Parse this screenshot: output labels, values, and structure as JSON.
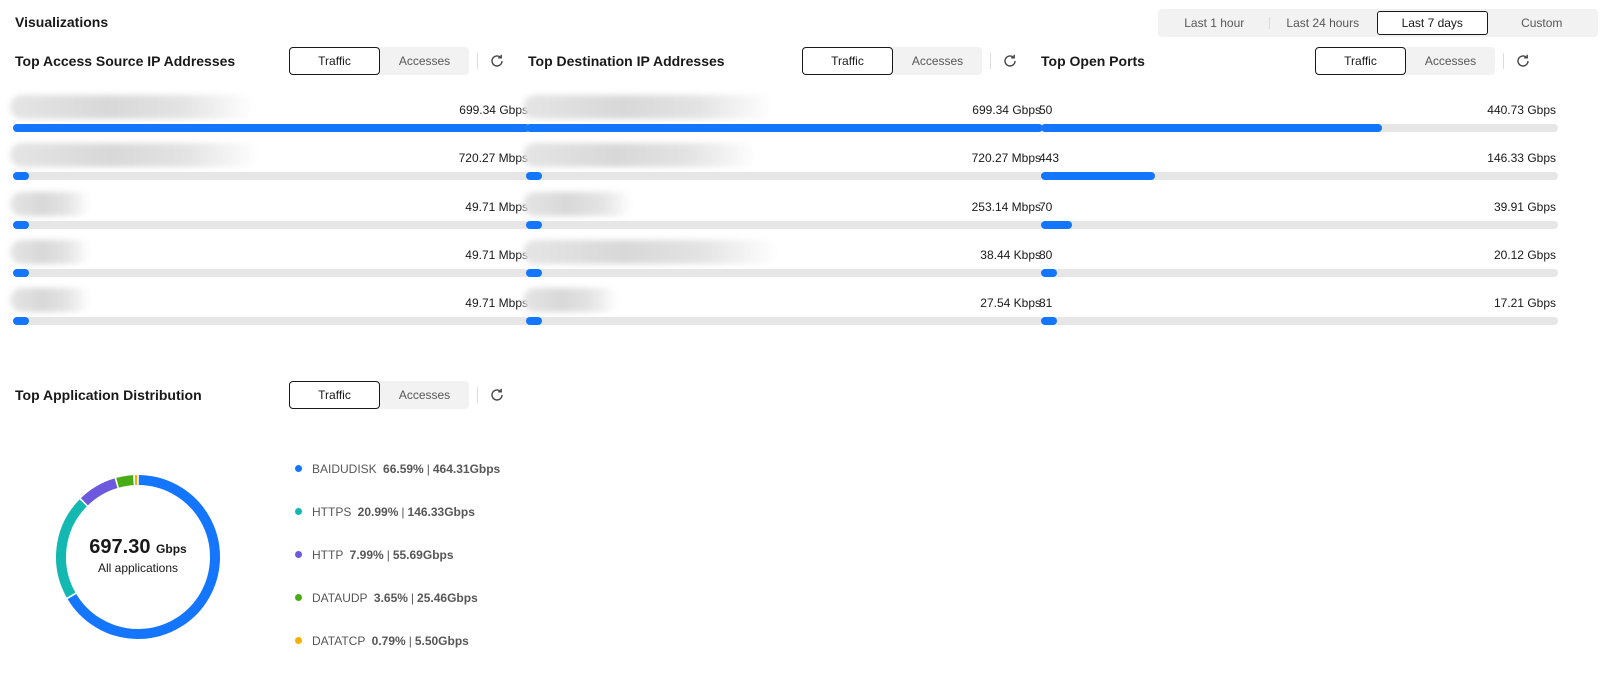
{
  "page": {
    "title": "Visualizations"
  },
  "time_range": {
    "options": [
      "Last 1 hour",
      "Last 24 hours",
      "Last 7 days",
      "Custom"
    ],
    "selected": "Last 7 days"
  },
  "panels": {
    "source_ip": {
      "title": "Top Access Source IP Addresses",
      "tabs": [
        "Traffic",
        "Accesses"
      ],
      "active_tab": "Traffic",
      "rows": [
        {
          "label": "",
          "value": "699.34 Gbps",
          "fraction": 1.0
        },
        {
          "label": "",
          "value": "720.27 Mbps",
          "fraction": 0.03
        },
        {
          "label": "",
          "value": "49.71 Mbps",
          "fraction": 0.03
        },
        {
          "label": "",
          "value": "49.71 Mbps",
          "fraction": 0.03
        },
        {
          "label": "",
          "value": "49.71 Mbps",
          "fraction": 0.03
        }
      ]
    },
    "dest_ip": {
      "title": "Top Destination IP Addresses",
      "tabs": [
        "Traffic",
        "Accesses"
      ],
      "active_tab": "Traffic",
      "rows": [
        {
          "label": "",
          "value": "699.34 Gbps",
          "fraction": 1.0
        },
        {
          "label": "",
          "value": "720.27 Mbps",
          "fraction": 0.03
        },
        {
          "label": "",
          "value": "253.14 Mbps",
          "fraction": 0.03
        },
        {
          "label": "",
          "value": "38.44 Kbps",
          "fraction": 0.03
        },
        {
          "label": "",
          "value": "27.54 Kbps",
          "fraction": 0.03
        }
      ]
    },
    "open_ports": {
      "title": "Top Open Ports",
      "tabs": [
        "Traffic",
        "Accesses"
      ],
      "active_tab": "Traffic",
      "rows": [
        {
          "label": "50",
          "value": "440.73 Gbps",
          "fraction": 0.66
        },
        {
          "label": "443",
          "value": "146.33 Gbps",
          "fraction": 0.22
        },
        {
          "label": "70",
          "value": "39.91 Gbps",
          "fraction": 0.06
        },
        {
          "label": "80",
          "value": "20.12 Gbps",
          "fraction": 0.03
        },
        {
          "label": "81",
          "value": "17.21 Gbps",
          "fraction": 0.03
        }
      ]
    },
    "app_dist": {
      "title": "Top Application Distribution",
      "tabs": [
        "Traffic",
        "Accesses"
      ],
      "active_tab": "Traffic",
      "total_value": "697.30",
      "total_unit": "Gbps",
      "total_label": "All applications",
      "chart_data": {
        "type": "pie",
        "series": [
          {
            "name": "BAIDUDISK",
            "percent": 66.59,
            "value": "464.31Gbps",
            "percent_label": "66.59%",
            "color": "#1476ff"
          },
          {
            "name": "HTTPS",
            "percent": 20.99,
            "value": "146.33Gbps",
            "percent_label": "20.99%",
            "color": "#13b8b0"
          },
          {
            "name": "HTTP",
            "percent": 7.99,
            "value": "55.69Gbps",
            "percent_label": "7.99%",
            "color": "#6c59de"
          },
          {
            "name": "DATAUDP",
            "percent": 3.65,
            "value": "25.46Gbps",
            "percent_label": "3.65%",
            "color": "#4aac15"
          },
          {
            "name": "DATATCP",
            "percent": 0.79,
            "value": "5.50Gbps",
            "percent_label": "0.79%",
            "color": "#f6b000"
          }
        ]
      }
    }
  }
}
